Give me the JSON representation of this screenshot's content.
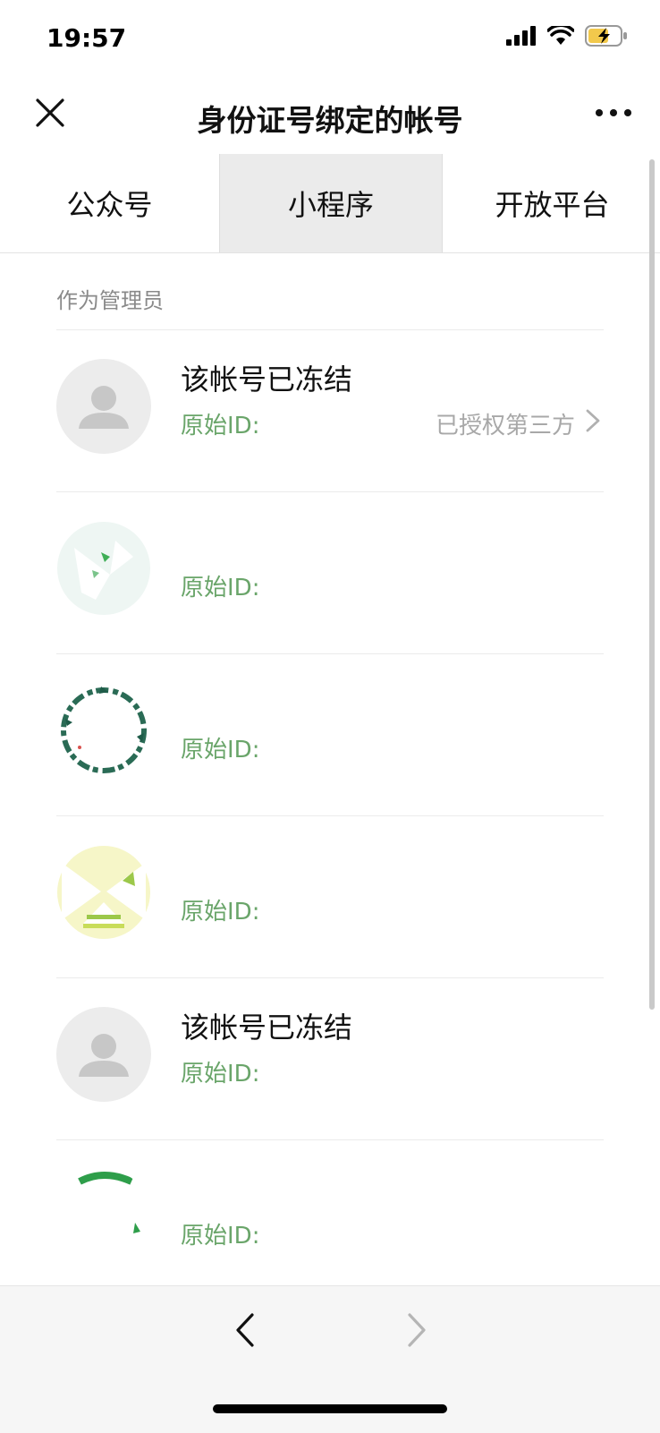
{
  "status": {
    "time": "19:57"
  },
  "nav": {
    "title": "身份证号绑定的帐号"
  },
  "tabs": [
    {
      "label": "公众号",
      "selected": false
    },
    {
      "label": "小程序",
      "selected": true
    },
    {
      "label": "开放平台",
      "selected": false
    }
  ],
  "section": {
    "label": "作为管理员"
  },
  "accounts": [
    {
      "name": "该帐号已冻结",
      "id_label": "原始ID:",
      "auth": "已授权第三方",
      "avatar": "default-avatar"
    },
    {
      "name": "",
      "id_label": "原始ID:",
      "auth": "",
      "avatar": "miniprogram-logo"
    },
    {
      "name": "",
      "id_label": "原始ID:",
      "auth": "",
      "avatar": "miniprogram-logo"
    },
    {
      "name": "",
      "id_label": "原始ID:",
      "auth": "",
      "avatar": "miniprogram-logo"
    },
    {
      "name": "该帐号已冻结",
      "id_label": "原始ID:",
      "auth": "",
      "avatar": "default-avatar"
    },
    {
      "name": "",
      "id_label": "原始ID:",
      "auth": "",
      "avatar": "miniprogram-logo"
    }
  ],
  "colors": {
    "id_green": "#6aa56a",
    "selected_tab_bg": "#ebebeb",
    "battery": "#f2c94c"
  }
}
